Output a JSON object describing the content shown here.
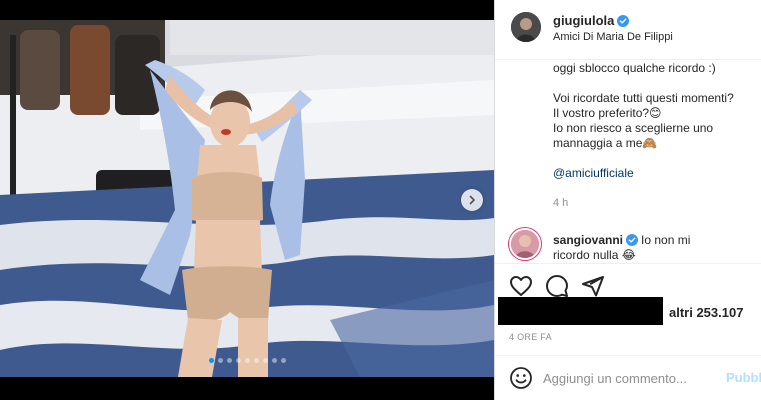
{
  "post": {
    "carousel": {
      "slide_count": 9,
      "active_index": 0
    }
  },
  "author": {
    "username": "giugiulola",
    "location": "Amici Di Maria De Filippi",
    "verified": true
  },
  "caption": {
    "lines": [
      "oggi sblocco qualche ricordo :)",
      "",
      "Voi ricordate tutti questi momenti?",
      "Il vostro preferito?😊",
      "Io non riesco a sceglierne uno",
      "mannaggia a me🙈",
      "",
      "@amiciufficiale"
    ],
    "time_ago": "4 h"
  },
  "comment": {
    "username": "sangiovanni",
    "text_line1": "Io non mi",
    "text_line2": "ricordo nulla 😂"
  },
  "actions": {
    "like_icon": "heart-icon",
    "comment_icon": "comment-icon",
    "share_icon": "share-icon"
  },
  "likes": {
    "text": "altri 253.107"
  },
  "post_time": "4 ORE FA",
  "add_comment": {
    "placeholder": "Aggiungi un commento...",
    "publish_label": "Pubblica"
  },
  "colors": {
    "verified_blue": "#3897f0",
    "link_blue": "#00376b",
    "publish_disabled": "#b2dffc",
    "muted_text": "#8e8e8e"
  }
}
